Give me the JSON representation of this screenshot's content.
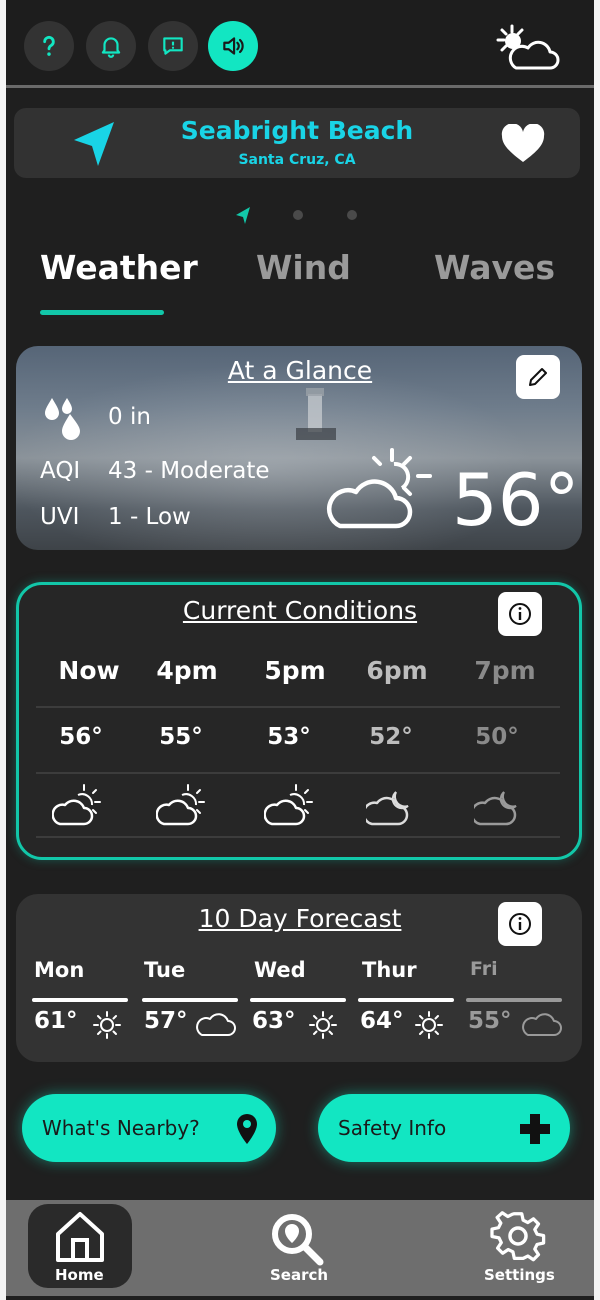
{
  "location": {
    "name": "Seabright Beach",
    "subtitle": "Santa Cruz, CA"
  },
  "tabs": [
    "Weather",
    "Wind",
    "Waves"
  ],
  "active_tab": "Weather",
  "glance": {
    "title": "At a Glance",
    "rain": "0 in",
    "aqi_label": "AQI",
    "aqi_value": "43 - Moderate",
    "uvi_label": "UVI",
    "uvi_value": "1 - Low",
    "temperature": "56°"
  },
  "current_conditions": {
    "title": "Current Conditions",
    "hours": [
      "Now",
      "4pm",
      "5pm",
      "6pm",
      "7pm"
    ],
    "temps": [
      "56°",
      "55°",
      "53°",
      "52°",
      "50°"
    ],
    "icons": [
      "partly-sunny-icon",
      "partly-sunny-icon",
      "partly-sunny-icon",
      "cloudy-night-icon",
      "cloudy-night-icon"
    ]
  },
  "forecast": {
    "title": "10 Day Forecast",
    "days": [
      {
        "day": "Mon",
        "temp": "61°",
        "icon": "sun-icon"
      },
      {
        "day": "Tue",
        "temp": "57°",
        "icon": "cloud-icon"
      },
      {
        "day": "Wed",
        "temp": "63°",
        "icon": "sun-icon"
      },
      {
        "day": "Thur",
        "temp": "64°",
        "icon": "sun-icon"
      },
      {
        "day": "Fri",
        "temp": "55°",
        "icon": "cloud-icon"
      }
    ]
  },
  "actions": {
    "nearby": "What's Nearby?",
    "safety": "Safety Info"
  },
  "nav": {
    "home": "Home",
    "search": "Search",
    "settings": "Settings"
  },
  "colors": {
    "accent": "#12e6c2",
    "location_text": "#19d4e6",
    "background": "#1f1f1f"
  }
}
